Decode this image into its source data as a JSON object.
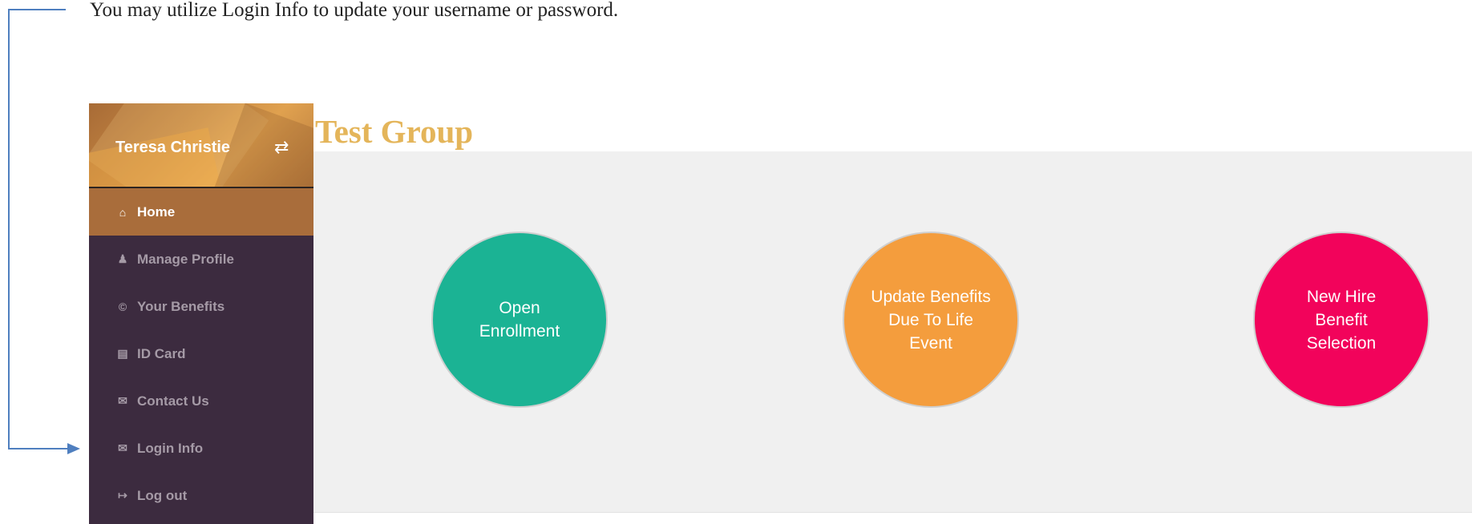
{
  "instruction": "You may utilize Login Info to update your username or password.",
  "sidebar": {
    "user_name": "Teresa Christie",
    "switch_icon": "exchange-icon",
    "items": [
      {
        "label": "Home",
        "icon": "home-icon",
        "glyph": "⌂",
        "active": true
      },
      {
        "label": "Manage Profile",
        "icon": "user-icon",
        "glyph": "♟"
      },
      {
        "label": "Your Benefits",
        "icon": "cc-icon",
        "glyph": "©"
      },
      {
        "label": "ID Card",
        "icon": "id-card-icon",
        "glyph": "▤"
      },
      {
        "label": "Contact Us",
        "icon": "envelope-icon",
        "glyph": "✉"
      },
      {
        "label": "Login Info",
        "icon": "envelope-icon",
        "glyph": "✉"
      },
      {
        "label": "Log out",
        "icon": "sign-out-icon",
        "glyph": "↦"
      }
    ]
  },
  "main": {
    "group_title": "Test Group",
    "actions": [
      {
        "label": "Open Enrollment",
        "color": "#1bb394"
      },
      {
        "label": "Update Benefits Due To Life Event",
        "color": "#f49d3d"
      },
      {
        "label": "New Hire Benefit Selection",
        "color": "#f2035b"
      }
    ]
  },
  "colors": {
    "sidebar_bg": "#3c2b3f",
    "active_item": "#a96d3b",
    "title_gold": "#e4b55a",
    "callout_blue": "#4f7fbf"
  }
}
